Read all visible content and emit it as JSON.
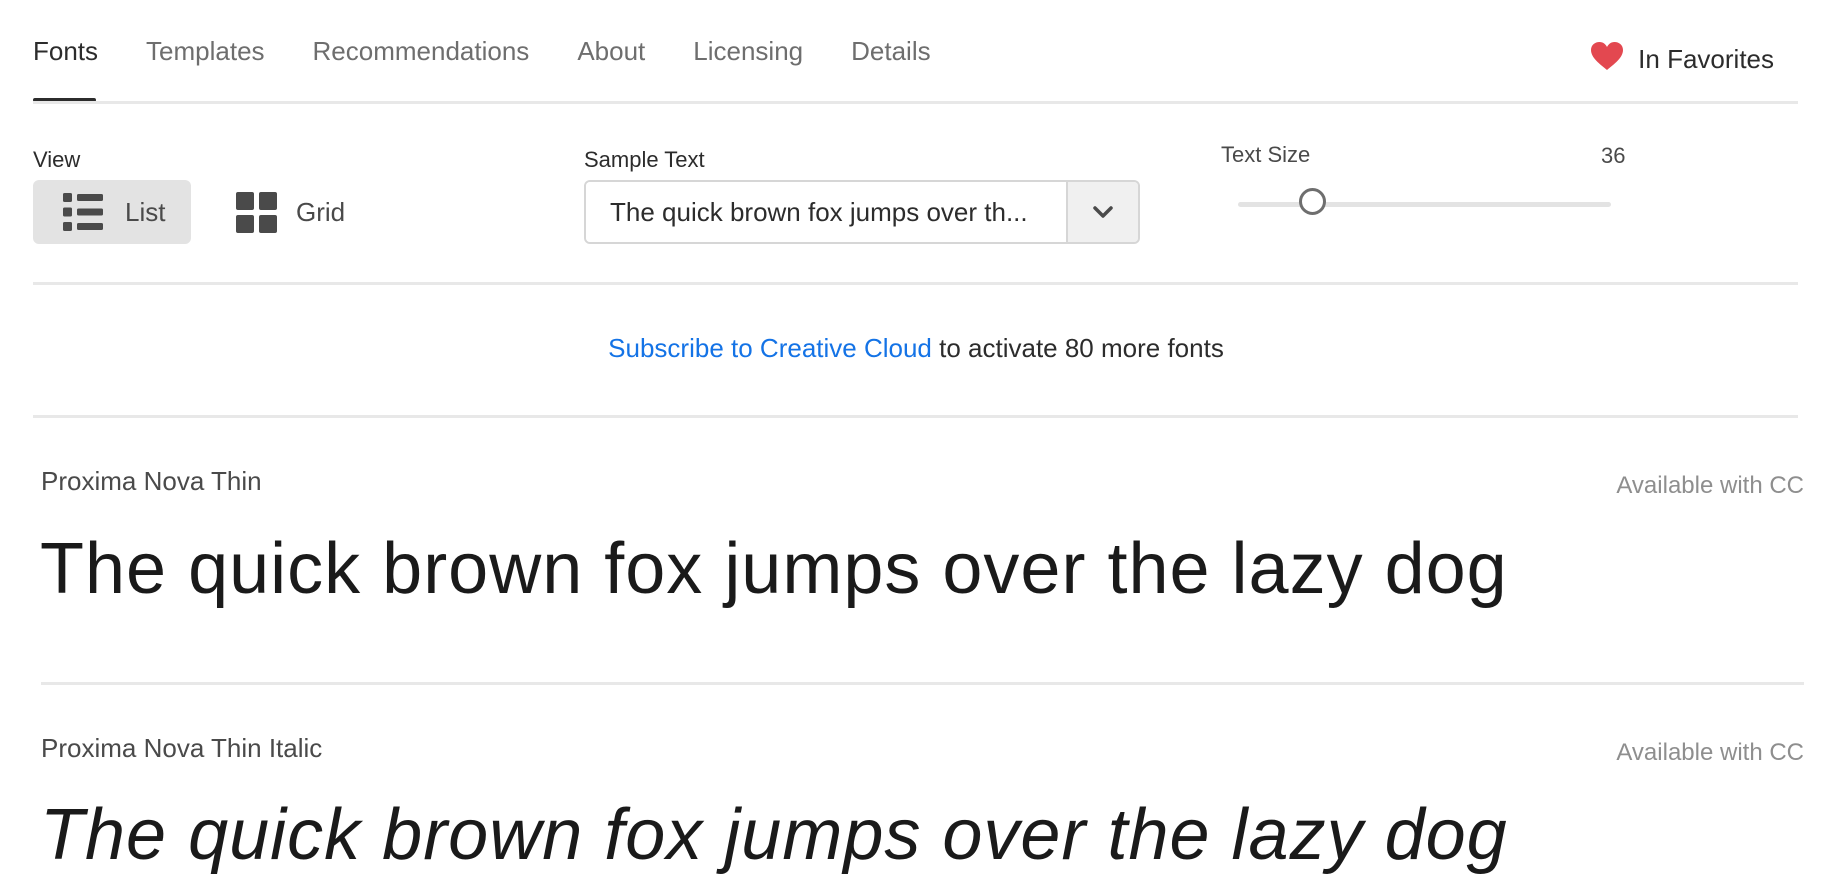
{
  "tabs": [
    {
      "label": "Fonts",
      "active": true
    },
    {
      "label": "Templates",
      "active": false
    },
    {
      "label": "Recommendations",
      "active": false
    },
    {
      "label": "About",
      "active": false
    },
    {
      "label": "Licensing",
      "active": false
    },
    {
      "label": "Details",
      "active": false
    }
  ],
  "favorites": {
    "label": "In Favorites",
    "icon": "heart-icon",
    "color": "#e34850"
  },
  "view": {
    "label": "View",
    "options": [
      {
        "label": "List",
        "icon": "list-icon",
        "selected": true
      },
      {
        "label": "Grid",
        "icon": "grid-icon",
        "selected": false
      }
    ]
  },
  "sample_text": {
    "label": "Sample Text",
    "value": "The quick brown fox jumps over th...",
    "dropdown_icon": "chevron-down-icon"
  },
  "text_size": {
    "label": "Text Size",
    "value": "36",
    "level": 0.2
  },
  "subscribe": {
    "link_text": "Subscribe to Creative Cloud",
    "rest_text": " to activate 80 more fonts",
    "link_color": "#1473e6"
  },
  "fonts": [
    {
      "name": "Proxima Nova Thin",
      "availability": "Available with CC",
      "sample": "The quick brown fox jumps over the lazy dog",
      "italic": false
    },
    {
      "name": "Proxima Nova Thin Italic",
      "availability": "Available with CC",
      "sample": "The quick brown fox jumps over the lazy dog",
      "italic": true
    }
  ]
}
